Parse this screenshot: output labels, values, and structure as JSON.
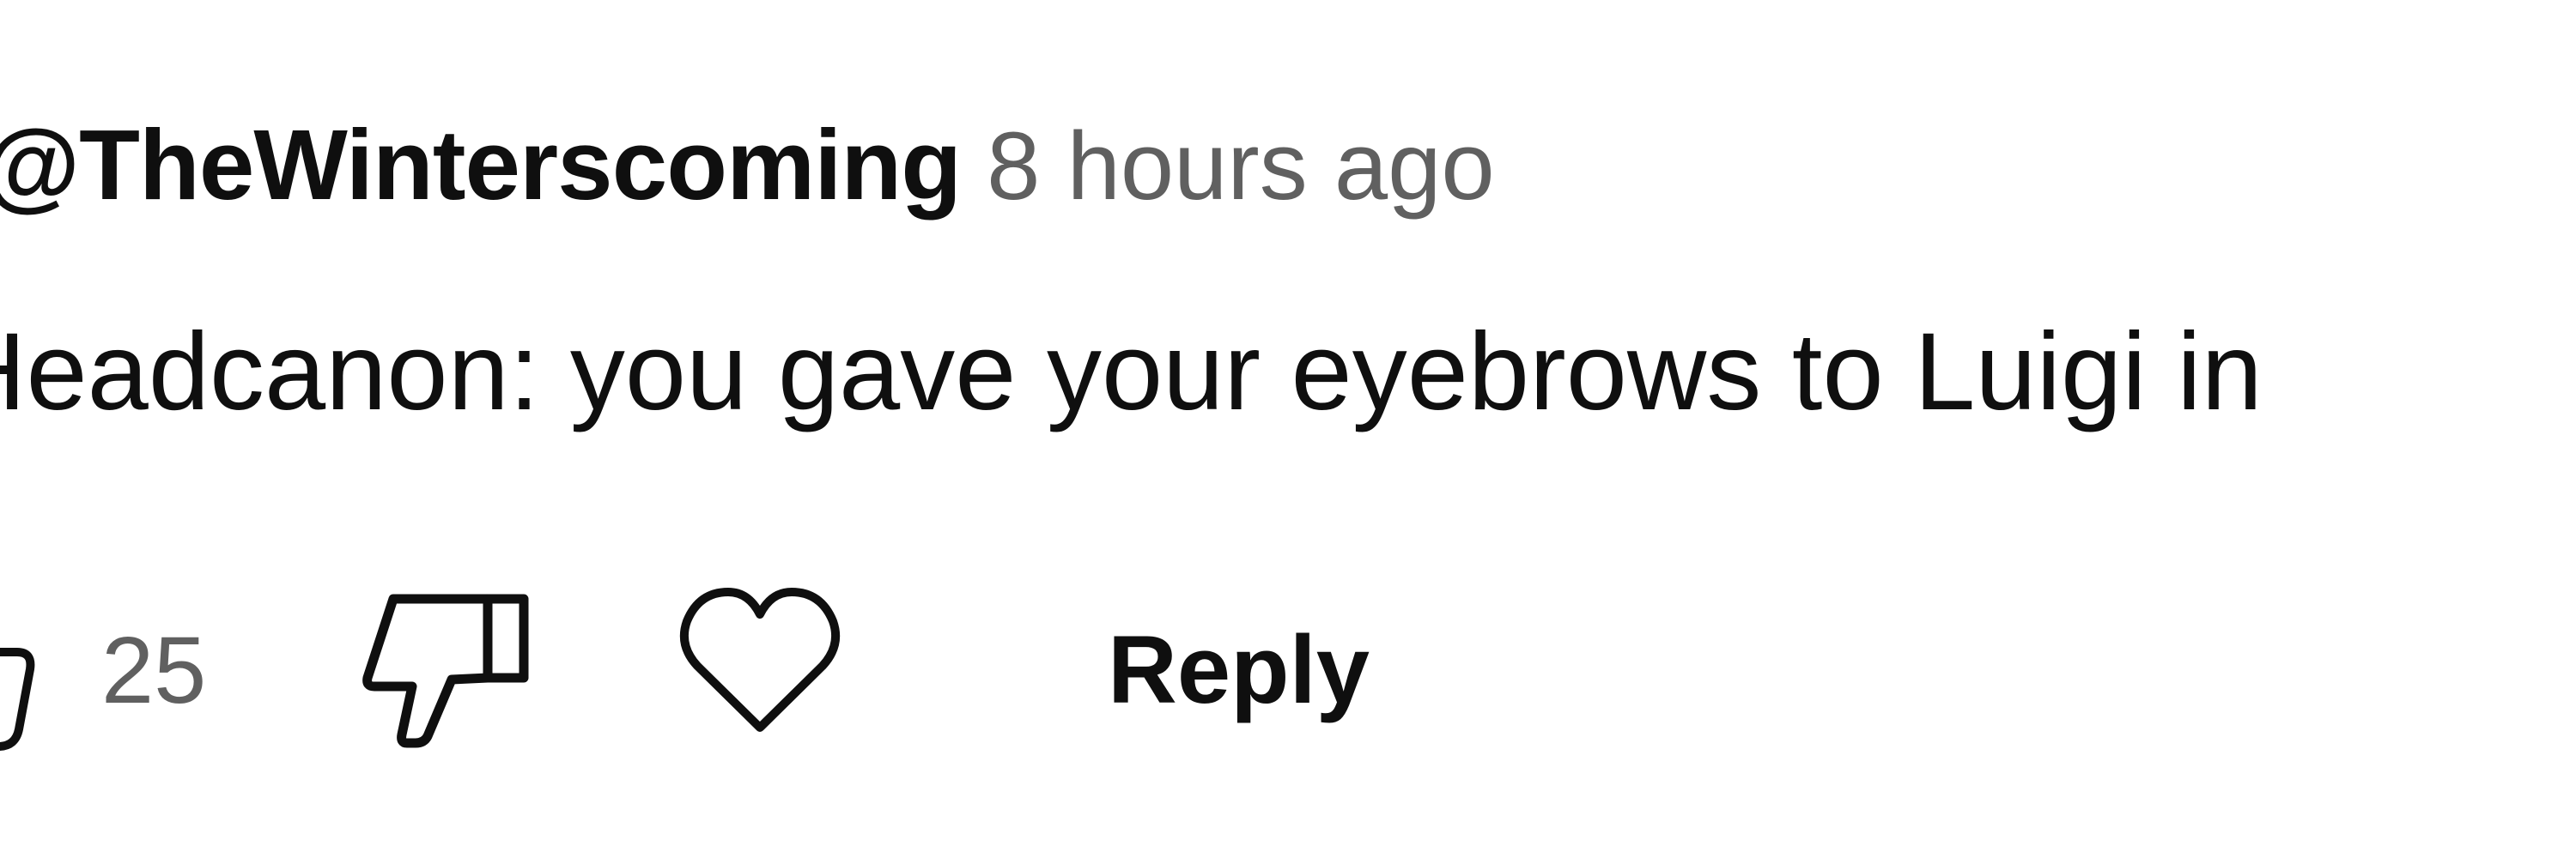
{
  "comment": {
    "author": "@TheWinterscoming",
    "timestamp": "8 hours ago",
    "text": "Headcanon: you gave your eyebrows to Luigi in",
    "like_count": "25",
    "reply_label": "Reply"
  },
  "icons": {
    "like": "thumbs-up-icon",
    "dislike": "thumbs-down-icon",
    "heart": "heart-icon"
  },
  "colors": {
    "primary_text": "#0f0f0f",
    "secondary_text": "#606060"
  }
}
